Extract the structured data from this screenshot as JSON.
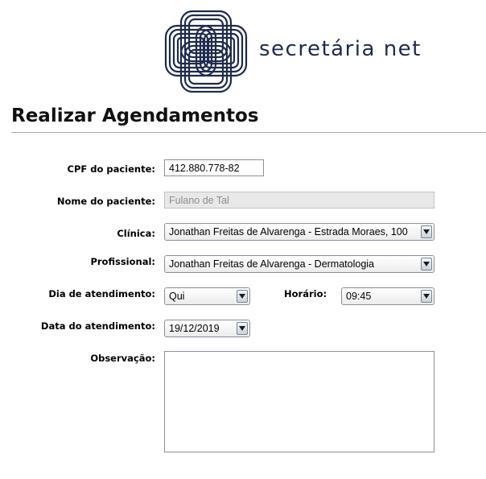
{
  "brand": {
    "name": "secretária net",
    "logo_icon": "interlaced-knot-logo-icon",
    "color": "#1f2a4d"
  },
  "page": {
    "title": "Realizar Agendamentos"
  },
  "form": {
    "cpf": {
      "label": "CPF do paciente:",
      "value": "412.880.778-82"
    },
    "nome": {
      "label": "Nome do paciente:",
      "value": "Fulano de Tal"
    },
    "clinica": {
      "label": "Clínica:",
      "value": "Jonathan Freitas de Alvarenga - Estrada Moraes, 100"
    },
    "profissional": {
      "label": "Profissional:",
      "value": "Jonathan Freitas de Alvarenga - Dermatologia"
    },
    "dia": {
      "label": "Dia de atendimento:",
      "value": "Qui"
    },
    "horario": {
      "label": "Horário:",
      "value": "09:45"
    },
    "data": {
      "label": "Data do atendimento:",
      "value": "19/12/2019"
    },
    "observacao": {
      "label": "Observação:",
      "value": ""
    }
  }
}
